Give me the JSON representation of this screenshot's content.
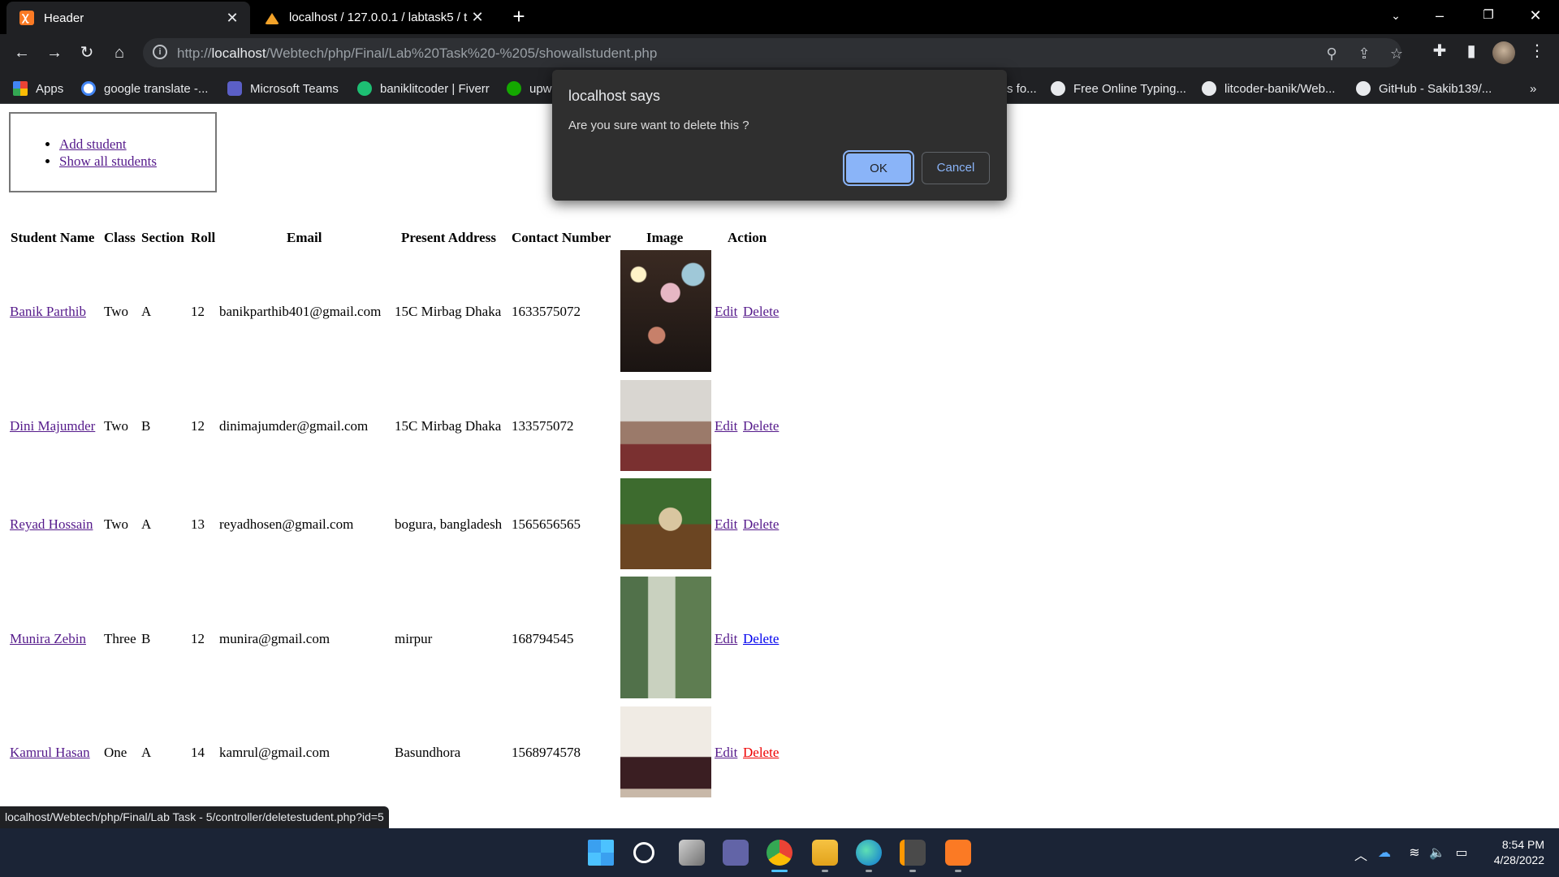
{
  "browser": {
    "tabs": [
      {
        "title": "Header",
        "active": true
      },
      {
        "title": "localhost / 127.0.0.1 / labtask5 / t",
        "active": false
      }
    ],
    "new_tab": "+",
    "address_prefix": "http://",
    "address_host": "localhost",
    "address_path": "/Webtech/php/Final/Lab%20Task%20-%205/showallstudent.php",
    "bookmarks": [
      {
        "label": "Apps",
        "icon": "apps-grid-icon"
      },
      {
        "label": "google translate -...",
        "icon": "google-icon"
      },
      {
        "label": "Microsoft Teams",
        "icon": "teams-icon"
      },
      {
        "label": "baniklitcoder | Fiverr",
        "icon": "fiverr-icon"
      },
      {
        "label": "upw",
        "icon": "upwork-icon"
      },
      {
        "label": "s fo...",
        "icon": ""
      },
      {
        "label": "Free Online Typing...",
        "icon": "paw-icon"
      },
      {
        "label": "litcoder-banik/Web...",
        "icon": "github-icon"
      },
      {
        "label": "GitHub - Sakib139/...",
        "icon": "github-icon"
      }
    ],
    "more_bookmarks": "»",
    "status_url": "localhost/Webtech/php/Final/Lab Task - 5/controller/deletestudent.php?id=5"
  },
  "nav": {
    "items": [
      "Add student",
      "Show all students"
    ]
  },
  "table": {
    "headers": [
      "Student Name",
      "Class",
      "Section",
      "Roll",
      "Email",
      "Present Address",
      "Contact Number",
      "Image",
      "Action"
    ],
    "rows": [
      {
        "name": "Banik Parthib",
        "class": "Two",
        "section": "A",
        "roll": "12",
        "email": "banikparthib401@gmail.com",
        "address": "15C Mirbag Dhaka",
        "contact": "1633575072"
      },
      {
        "name": "Dini Majumder",
        "class": "Two",
        "section": "B",
        "roll": "12",
        "email": "dinimajumder@gmail.com",
        "address": "15C Mirbag Dhaka",
        "contact": "133575072"
      },
      {
        "name": "Reyad Hossain",
        "class": "Two",
        "section": "A",
        "roll": "13",
        "email": "reyadhosen@gmail.com",
        "address": "bogura, bangladesh",
        "contact": "1565656565"
      },
      {
        "name": "Munira Zebin",
        "class": "Three",
        "section": "B",
        "roll": "12",
        "email": "munira@gmail.com",
        "address": "mirpur",
        "contact": "168794545"
      },
      {
        "name": "Kamrul Hasan",
        "class": "One",
        "section": "A",
        "roll": "14",
        "email": "kamrul@gmail.com",
        "address": "Basundhora",
        "contact": "1568974578"
      }
    ],
    "edit_label": "Edit",
    "delete_label": "Delete"
  },
  "dialog": {
    "title": "localhost says",
    "message": "Are you sure want to delete this ?",
    "ok": "OK",
    "cancel": "Cancel"
  },
  "taskbar": {
    "time": "8:54 PM",
    "date": "4/28/2022"
  }
}
